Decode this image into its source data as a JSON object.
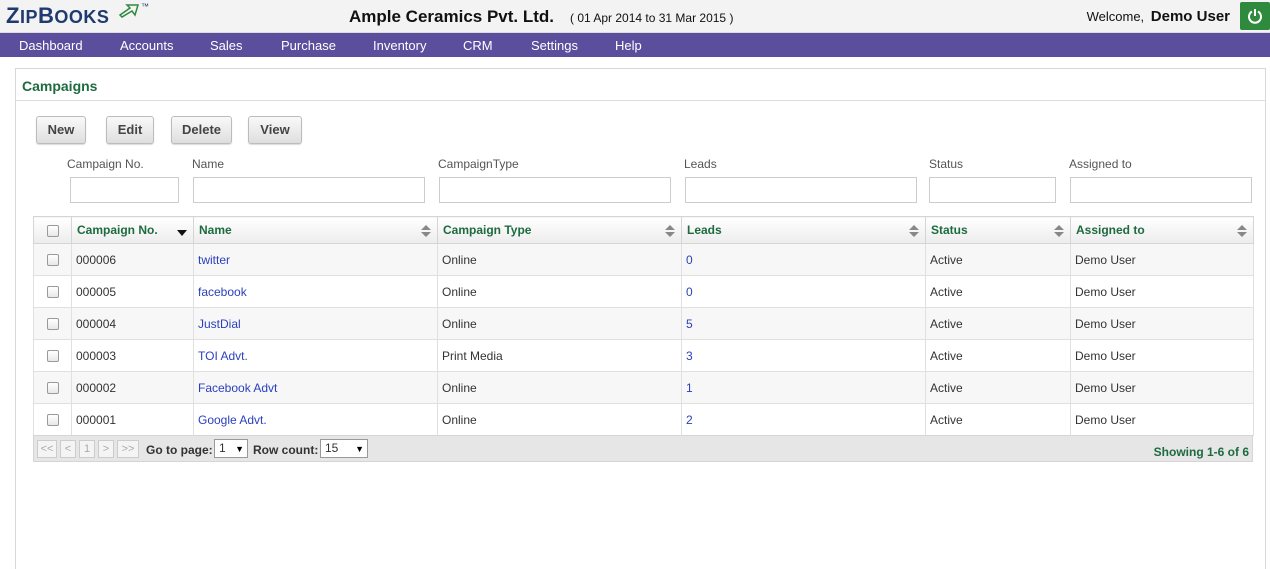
{
  "brand": {
    "logo": "ZipBooks",
    "tm": "™"
  },
  "header": {
    "company": "Ample Ceramics Pvt. Ltd.",
    "period": "( 01 Apr 2014 to 31 Mar 2015 )",
    "welcome": "Welcome,",
    "user": "Demo User"
  },
  "nav": [
    "Dashboard",
    "Accounts",
    "Sales",
    "Purchase",
    "Inventory",
    "CRM",
    "Settings",
    "Help"
  ],
  "page": {
    "title": "Campaigns"
  },
  "actions": {
    "new": "New",
    "edit": "Edit",
    "delete": "Delete",
    "view": "View"
  },
  "filters": {
    "campaign_no": {
      "label": "Campaign No.",
      "value": ""
    },
    "name": {
      "label": "Name",
      "value": ""
    },
    "campaign_type": {
      "label": "CampaignType",
      "value": ""
    },
    "leads": {
      "label": "Leads",
      "value": ""
    },
    "status": {
      "label": "Status",
      "value": ""
    },
    "assigned_to": {
      "label": "Assigned to",
      "value": ""
    }
  },
  "table": {
    "columns": [
      "Campaign No.",
      "Name",
      "Campaign Type",
      "Leads",
      "Status",
      "Assigned to"
    ],
    "sorted_column": "Campaign No.",
    "sort_direction": "descending",
    "rows": [
      [
        "000006",
        "twitter",
        "Online",
        "0",
        "Active",
        "Demo User"
      ],
      [
        "000005",
        "facebook",
        "Online",
        "0",
        "Active",
        "Demo User"
      ],
      [
        "000004",
        "JustDial",
        "Online",
        "5",
        "Active",
        "Demo User"
      ],
      [
        "000003",
        "TOI Advt.",
        "Print Media",
        "3",
        "Active",
        "Demo User"
      ],
      [
        "000002",
        "Facebook Advt",
        "Online",
        "1",
        "Active",
        "Demo User"
      ],
      [
        "000001",
        "Google Advt.",
        "Online",
        "2",
        "Active",
        "Demo User"
      ]
    ]
  },
  "pager": {
    "first": "<<",
    "prev": "<",
    "page": "1",
    "next": ">",
    "last": ">>",
    "goto_label": "Go to page:",
    "goto_value": "1",
    "rowcount_label": "Row count:",
    "rowcount_value": "15",
    "showing": "Showing 1-6 of 6"
  },
  "colors": {
    "nav": "#5b4e9c",
    "accent_green": "#1d6b3f",
    "link_blue": "#2a3fbd",
    "power": "#2f8a3d"
  }
}
